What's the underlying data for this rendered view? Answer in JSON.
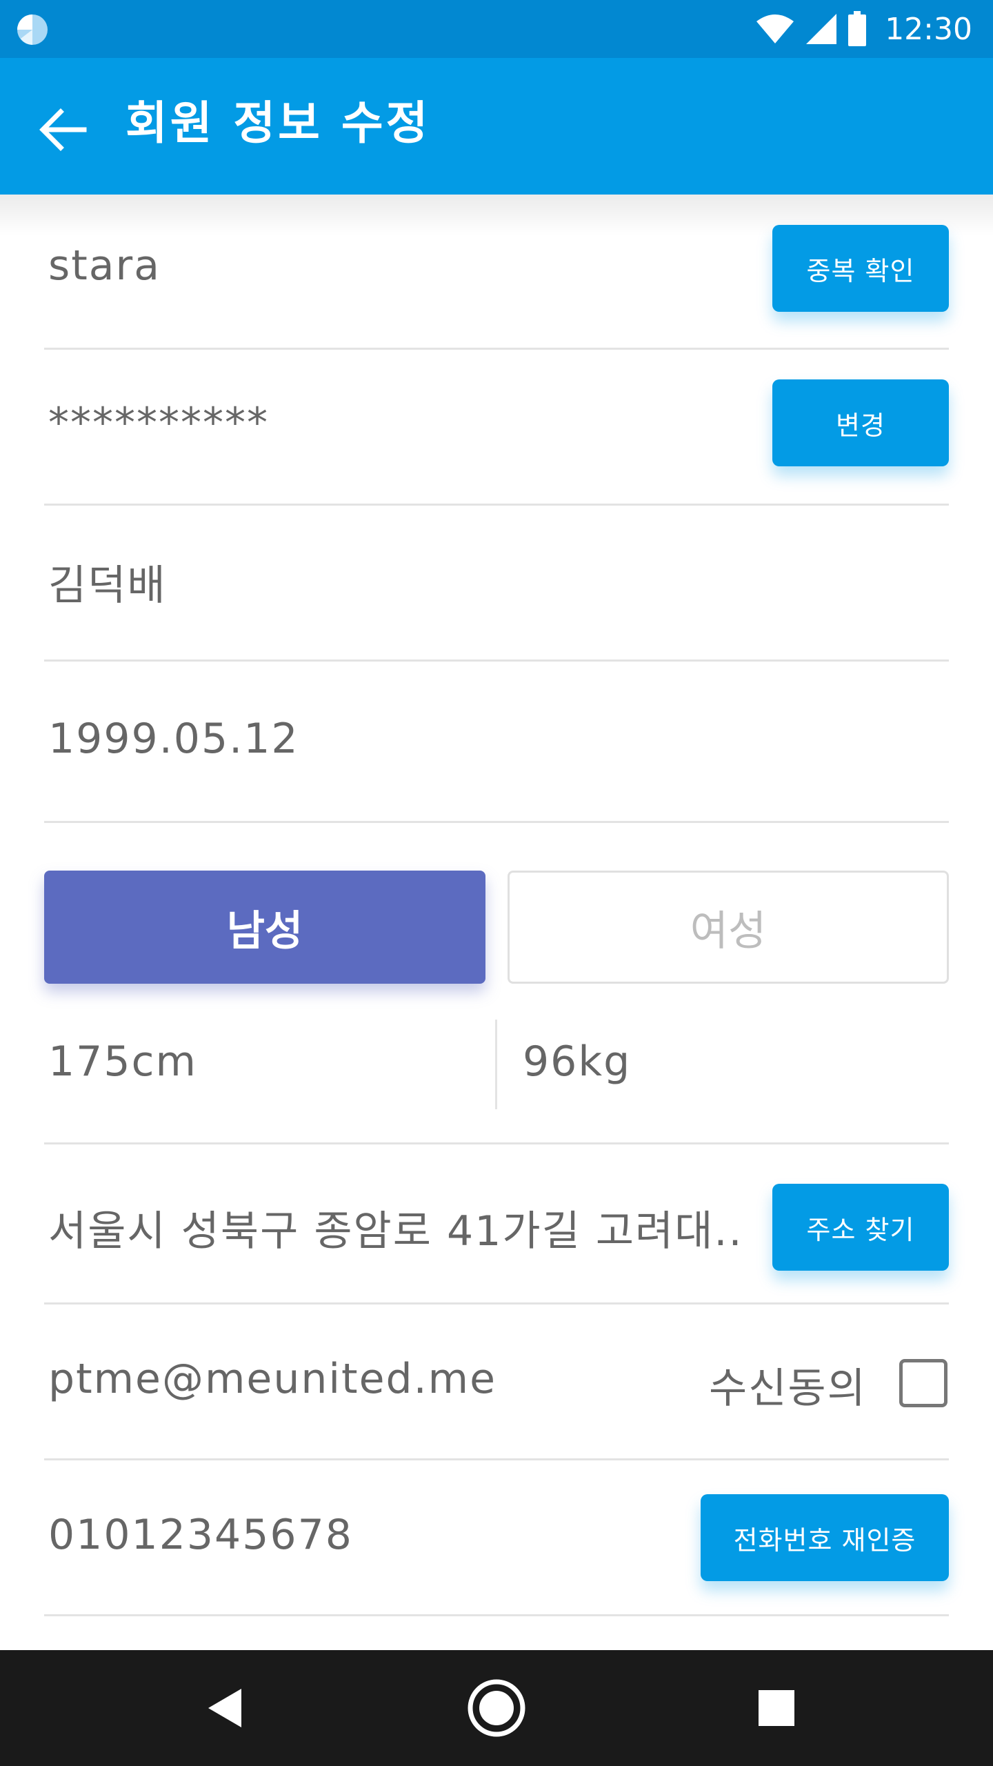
{
  "status_bar": {
    "time": "12:30",
    "icons": [
      "app-notification-icon",
      "wifi-icon",
      "cell-signal-icon",
      "battery-icon"
    ]
  },
  "app_bar": {
    "title": "회원 정보 수정",
    "back_icon": "arrow-left-icon"
  },
  "form": {
    "user_id": "stara",
    "duplicate_check_label": "중복 확인",
    "password": "**********",
    "change_password_label": "변경",
    "name": "김덕배",
    "birthdate": "1999.05.12",
    "gender": {
      "male_label": "남성",
      "female_label": "여성",
      "selected": "남성"
    },
    "height": "175cm",
    "weight": "96kg",
    "address": "서울시 성북구 종암로 41가길 고려대..",
    "find_address_label": "주소 찾기",
    "email": "ptme@meunited.me",
    "consent_label": "수신동의",
    "consent_checked": false,
    "phone": "01012345678",
    "reverify_phone_label": "전화번호 재인증"
  },
  "colors": {
    "status_bar": "#0288d1",
    "app_bar": "#039be5",
    "accent_button": "#039be5",
    "gender_selected": "#5c6bc0",
    "nav_bar": "#1a1a1a"
  },
  "nav_bar": {
    "icons": [
      "nav-back-icon",
      "nav-home-icon",
      "nav-recents-icon"
    ]
  }
}
